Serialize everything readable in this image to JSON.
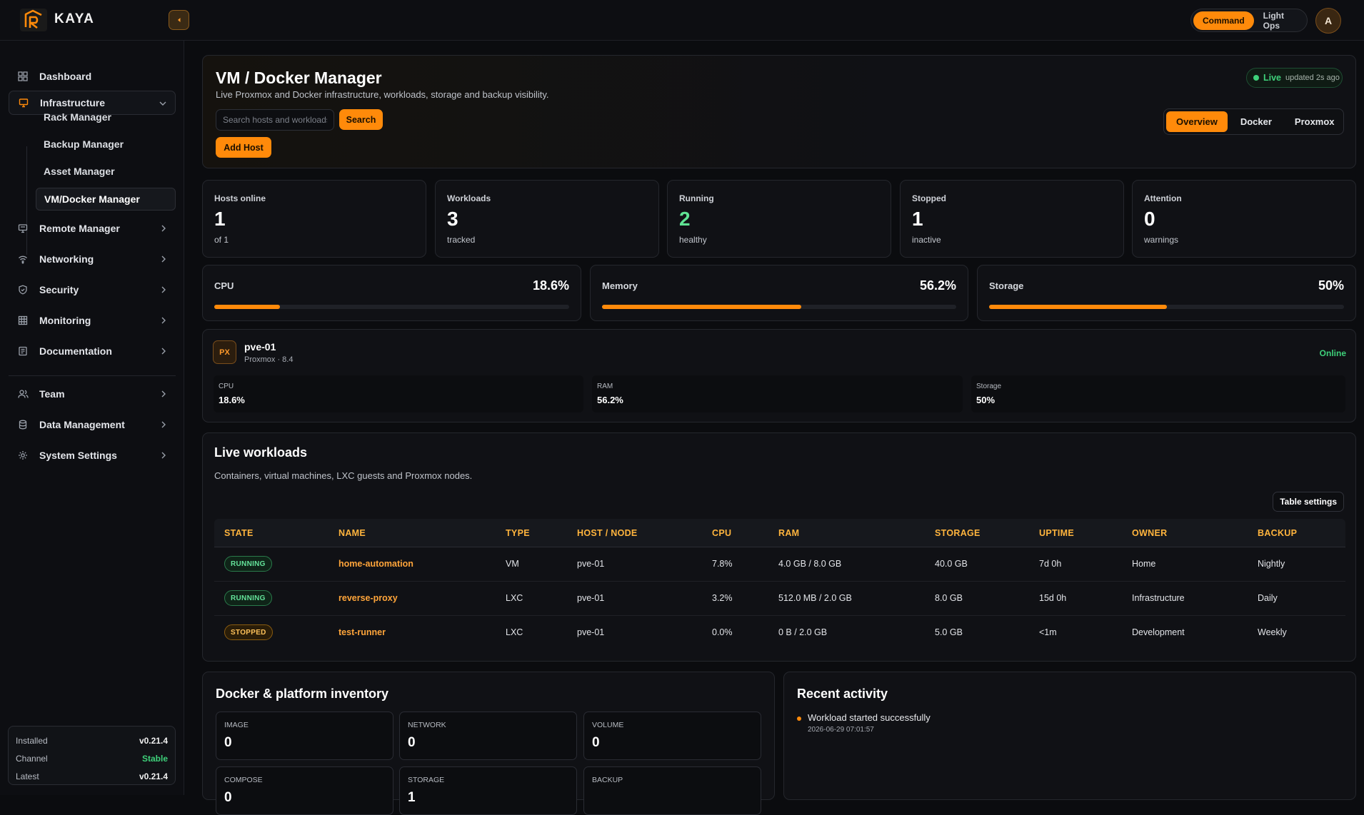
{
  "app": {
    "brand": "KAYA"
  },
  "header": {
    "modes": [
      "Command",
      "Light Ops"
    ],
    "active_mode": "Command",
    "avatar_initial": "A"
  },
  "sidebar": {
    "items": [
      {
        "label": "Dashboard",
        "icon": "grid-icon"
      },
      {
        "label": "Infrastructure",
        "icon": "monitor-icon",
        "open": true,
        "children": [
          "Rack Manager",
          "Backup Manager",
          "Asset Manager",
          "VM/Docker Manager"
        ],
        "active_child": "VM/Docker Manager"
      },
      {
        "label": "Remote Manager",
        "icon": "screen-icon"
      },
      {
        "label": "Networking",
        "icon": "wifi-icon"
      },
      {
        "label": "Security",
        "icon": "shield-icon"
      },
      {
        "label": "Monitoring",
        "icon": "table-icon"
      },
      {
        "label": "Documentation",
        "icon": "document-icon"
      },
      {
        "label": "Team",
        "icon": "users-icon"
      },
      {
        "label": "Data Management",
        "icon": "database-icon"
      },
      {
        "label": "System Settings",
        "icon": "gear-icon"
      }
    ],
    "version": {
      "installed_label": "Installed",
      "installed": "v0.21.4",
      "channel_label": "Channel",
      "channel": "Stable",
      "latest_label": "Latest",
      "latest": "v0.21.4"
    }
  },
  "hero": {
    "title": "VM / Docker Manager",
    "description": "Live Proxmox and Docker infrastructure, workloads, storage and backup visibility.",
    "search_placeholder": "Search hosts and workloads",
    "search_label": "Search",
    "add_host_label": "Add Host",
    "live_label": "Live",
    "updated": "updated 2s ago",
    "tabs": [
      "Overview",
      "Docker",
      "Proxmox"
    ],
    "active_tab": "Overview"
  },
  "stats": [
    {
      "label": "Hosts online",
      "value": "1",
      "sub": "of 1"
    },
    {
      "label": "Workloads",
      "value": "3",
      "sub": "tracked"
    },
    {
      "label": "Running",
      "value": "2",
      "sub": "healthy"
    },
    {
      "label": "Stopped",
      "value": "1",
      "sub": "inactive"
    },
    {
      "label": "Attention",
      "value": "0",
      "sub": "warnings"
    }
  ],
  "meters": [
    {
      "label": "CPU",
      "display": "18.6%",
      "percent": 18.6
    },
    {
      "label": "Memory",
      "display": "56.2%",
      "percent": 56.2
    },
    {
      "label": "Storage",
      "display": "50%",
      "percent": 50
    }
  ],
  "host": {
    "badge": "PX",
    "name": "pve-01",
    "sub": "Proxmox · 8.4",
    "status": "Online",
    "metrics": [
      {
        "label": "CPU",
        "value": "18.6%"
      },
      {
        "label": "RAM",
        "value": "56.2%"
      },
      {
        "label": "Storage",
        "value": "50%"
      }
    ]
  },
  "workloads": {
    "title": "Live workloads",
    "description": "Containers, virtual machines, LXC guests and Proxmox nodes.",
    "settings_label": "Table settings",
    "columns": [
      "STATE",
      "NAME",
      "TYPE",
      "HOST / NODE",
      "CPU",
      "RAM",
      "STORAGE",
      "UPTIME",
      "OWNER",
      "BACKUP"
    ],
    "rows": [
      {
        "state": "RUNNING",
        "name": "home-automation",
        "type": "VM",
        "host": "pve-01",
        "cpu": "7.8%",
        "ram": "4.0 GB / 8.0 GB",
        "storage": "40.0 GB",
        "uptime": "7d 0h",
        "owner": "Home",
        "backup": "Nightly"
      },
      {
        "state": "RUNNING",
        "name": "reverse-proxy",
        "type": "LXC",
        "host": "pve-01",
        "cpu": "3.2%",
        "ram": "512.0 MB / 2.0 GB",
        "storage": "8.0 GB",
        "uptime": "15d 0h",
        "owner": "Infrastructure",
        "backup": "Daily"
      },
      {
        "state": "STOPPED",
        "name": "test-runner",
        "type": "LXC",
        "host": "pve-01",
        "cpu": "0.0%",
        "ram": "0 B / 2.0 GB",
        "storage": "5.0 GB",
        "uptime": "<1m",
        "owner": "Development",
        "backup": "Weekly"
      }
    ]
  },
  "inventory": {
    "title": "Docker & platform inventory",
    "cards": [
      {
        "label": "IMAGE",
        "value": "0"
      },
      {
        "label": "NETWORK",
        "value": "0"
      },
      {
        "label": "VOLUME",
        "value": "0"
      },
      {
        "label": "COMPOSE",
        "value": "0"
      },
      {
        "label": "STORAGE",
        "value": "1"
      },
      {
        "label": "BACKUP",
        "value": ""
      }
    ]
  },
  "activity": {
    "title": "Recent activity",
    "items": [
      {
        "title": "Workload started successfully",
        "time": "2026-06-29 07:01:57"
      }
    ]
  },
  "colors": {
    "accent": "#ff8a0a",
    "success": "#3ed07a",
    "warning": "#ffc25a",
    "background": "#0b0c0f"
  }
}
